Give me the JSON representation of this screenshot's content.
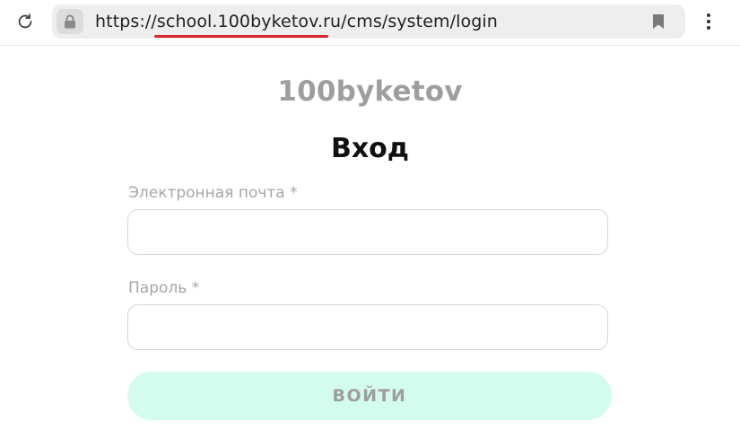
{
  "browser": {
    "url": "https://school.100byketov.ru/cms/system/login",
    "reload_icon": "reload-icon",
    "lock_icon": "lock-icon",
    "bookmark_icon": "bookmark-icon",
    "menu_icon": "more-vertical-icon",
    "underline_color": "#d8262f"
  },
  "page": {
    "brand": "100byketov",
    "heading": "Вход",
    "email": {
      "label": "Электронная почта *",
      "value": "",
      "placeholder": ""
    },
    "password": {
      "label": "Пароль *",
      "value": "",
      "placeholder": ""
    },
    "submit_label": "ВОЙТИ",
    "submit_color": "#d3fbee"
  }
}
